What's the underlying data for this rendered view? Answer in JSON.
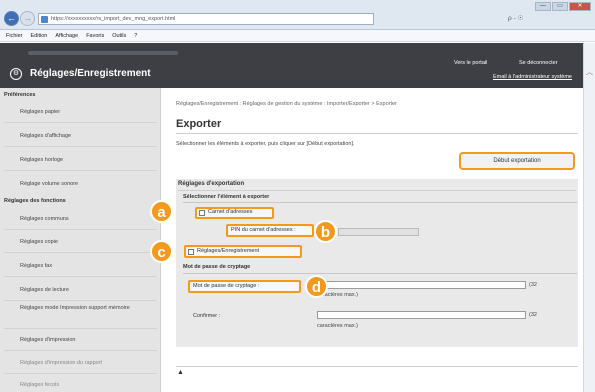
{
  "browser": {
    "address": "https://xxxxxxxxxx/rs_import_dev_mng_export.html",
    "search_control": "ρ - ☉",
    "nav_back": "←",
    "nav_forward": "→",
    "window_buttons": [
      "—",
      "▭",
      "✕"
    ],
    "menu": [
      "Fichier",
      "Edition",
      "Affichage",
      "Favoris",
      "Outils",
      "?"
    ]
  },
  "header": {
    "title": "Réglages/Enregistrement",
    "portal_link": "Vers le portail",
    "logout_link": "Se déconnecter",
    "email_link": "Email à l'administrateur système"
  },
  "sidebar": {
    "section_preferences": "Préférences",
    "preferences_items": [
      "Réglages papier",
      "Réglages d'affichage",
      "Réglages horloge",
      "Réglage volume sonore"
    ],
    "section_functions": "Réglages des fonctions",
    "function_items": [
      "Réglages communs",
      "Réglages copie",
      "Réglages fax",
      "Réglages de lecture",
      "Réglages mode Impression support mémoire",
      "Réglages d'impression",
      "Réglages d'impression du rapport",
      "Réglages fecols"
    ]
  },
  "main": {
    "breadcrumb": "Réglages/Enregistrement : Réglages de gestion du système : Importer/Exporter > Exporter",
    "title": "Exporter",
    "instruction": "Sélectionner les éléments à exporter, puis cliquer sur [Début exportation].",
    "start_button": "Début exportation",
    "panel_title": "Réglages d'exportation",
    "select_heading": "Sélectionner l'élément à exporter",
    "address_book_label": "Carnet d'adresses",
    "pin_label": "PIN du carnet d'adresses :",
    "settings_label": "Réglages/Enregistrement",
    "password_heading": "Mot de passe de cryptage",
    "password_label": "Mot de passe de cryptage :",
    "password_value": "",
    "password_note_suffix": "(32",
    "password_note": "caractères max.)",
    "confirm_label": "Confirmer :",
    "confirm_value": "",
    "confirm_note_suffix": "(32",
    "confirm_note": "caractères max.)",
    "top_anchor": "▲"
  },
  "callouts": [
    "a",
    "b",
    "c",
    "d"
  ],
  "colors": {
    "accent": "#f39a1d",
    "header_bg": "#3d3f44",
    "sidebar_bg": "#e4e4e4",
    "panel_bg": "#e9e9ea"
  }
}
